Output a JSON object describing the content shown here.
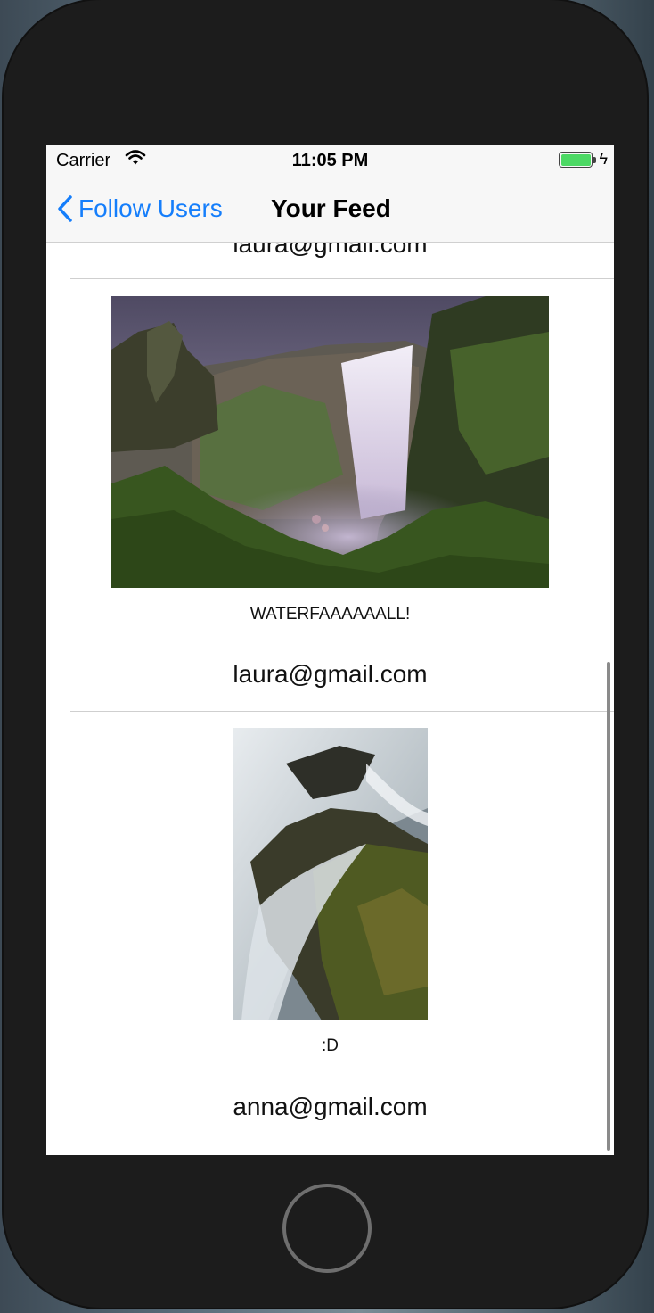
{
  "status_bar": {
    "carrier": "Carrier",
    "time": "11:05 PM"
  },
  "nav": {
    "back_label": "Follow Users",
    "title": "Your Feed"
  },
  "feed": {
    "top_partial_user": "laura@gmail.com",
    "posts": [
      {
        "caption": "WATERFAAAAAALL!",
        "user": "laura@gmail.com"
      },
      {
        "caption": ":D",
        "user": "anna@gmail.com"
      }
    ]
  },
  "colors": {
    "accent": "#157efb",
    "battery": "#4cd964"
  }
}
